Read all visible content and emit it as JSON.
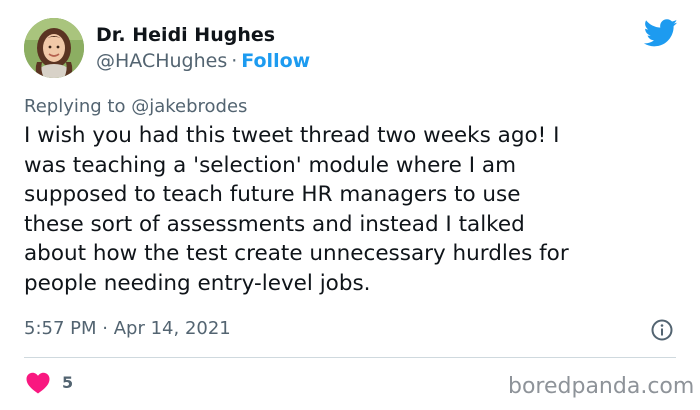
{
  "author": {
    "name": "Dr. Heidi Hughes",
    "handle": "@HACHughes",
    "separator": "·",
    "follow_label": "Follow"
  },
  "reply": {
    "prefix": "Replying to",
    "mention": "@jakebrodes"
  },
  "tweet": {
    "lines": [
      "I wish you had this tweet thread two weeks ago! I",
      "was teaching a 'selection' module where I am",
      "supposed to teach future HR managers to use",
      "these sort of assessments and instead I talked",
      "about how the test create unnecessary hurdles for",
      "people needing entry-level jobs."
    ]
  },
  "meta": {
    "time": "5:57 PM",
    "separator": "·",
    "date": "Apr 14, 2021"
  },
  "engagement": {
    "likes": "5"
  },
  "watermark": "boredpanda.com",
  "icons": {
    "brand": "twitter-bird-icon",
    "info": "info-icon",
    "like": "heart-icon"
  },
  "colors": {
    "accent": "#1d9bf0",
    "like": "#f91880",
    "muted": "#536471",
    "text": "#0f1419"
  }
}
